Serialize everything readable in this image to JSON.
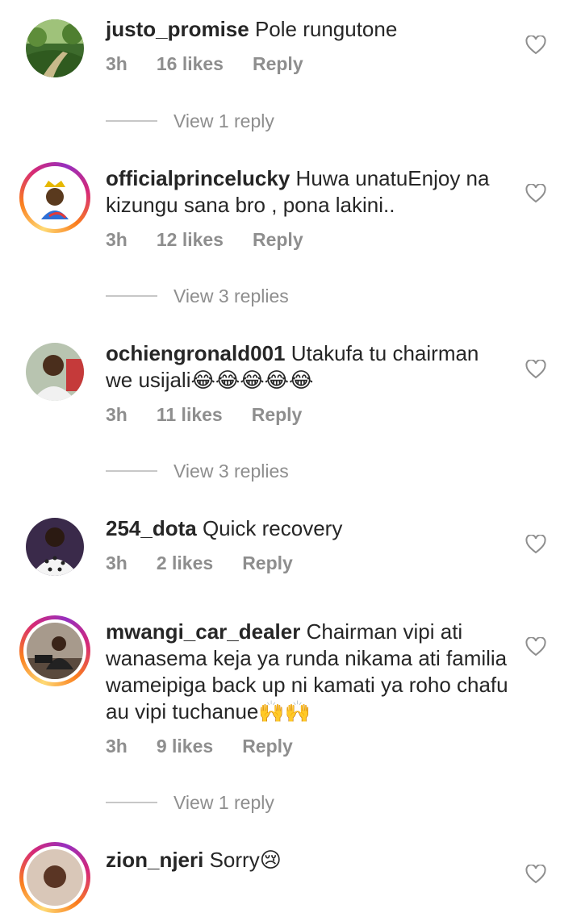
{
  "comments": [
    {
      "username": "justo_promise",
      "text": " Pole runguton‍e",
      "time": "3h",
      "likes": "16 likes",
      "reply": "Reply",
      "replies": "View 1 reply",
      "avatar": "park-photo"
    },
    {
      "username": "officialprincelucky",
      "text": " Huwa unatuEnjoy na kizungu sana bro , pona lakini..",
      "time": "3h",
      "likes": "12 likes",
      "reply": "Reply",
      "replies": "View 3 replies",
      "avatar": "crown-cartoon"
    },
    {
      "username": "ochiengronald001",
      "text": " Utakufa tu chairman we usijali",
      "emoji": "😂😂😂😂😂",
      "time": "3h",
      "likes": "11 likes",
      "reply": "Reply",
      "replies": "View 3 replies",
      "avatar": "man-photo"
    },
    {
      "username": "254_dota",
      "text": " Quick recovery",
      "time": "3h",
      "likes": "2 likes",
      "reply": "Reply",
      "avatar": "dotted-shirt-photo"
    },
    {
      "username": "mwangi_car_dealer",
      "text": " Chairman vipi ati wanasema keja ya runda nikama ati familia wameipiga back up ni kamati ya roho chafu au vipi tuchanue",
      "emoji": "🙌🙌",
      "time": "3h",
      "likes": "9 likes",
      "reply": "Reply",
      "replies": "View 1 reply",
      "avatar": "car-photo"
    },
    {
      "username": "zion_njeri",
      "text": " Sorry",
      "emoji": "😢",
      "avatar": "woman-photo"
    }
  ],
  "icons": {
    "like": "heart-outline-icon"
  }
}
